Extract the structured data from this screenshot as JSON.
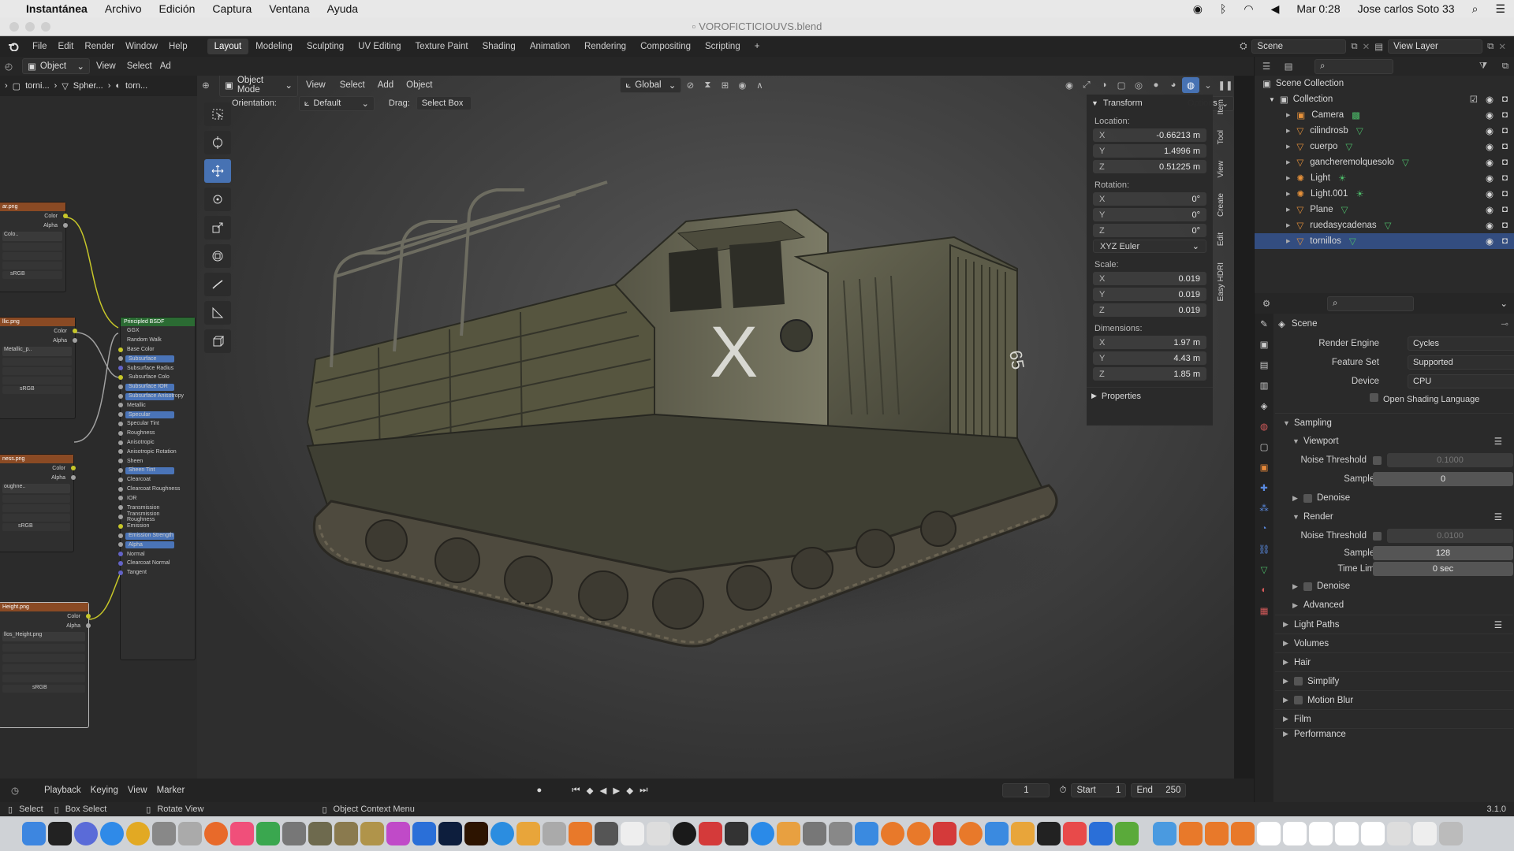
{
  "macbar": {
    "app_name": "Instantánea",
    "menus": [
      "Archivo",
      "Edición",
      "Captura",
      "Ventana",
      "Ayuda"
    ],
    "clock": "Mar 0:28",
    "user": "Jose carlos Soto 33"
  },
  "window": {
    "title": "VOROFICTICIOUVS.blend"
  },
  "blender_menus": [
    "File",
    "Edit",
    "Render",
    "Window",
    "Help"
  ],
  "workspaces": [
    "Layout",
    "Modeling",
    "Sculpting",
    "UV Editing",
    "Texture Paint",
    "Shading",
    "Animation",
    "Rendering",
    "Compositing",
    "Scripting"
  ],
  "scene_selector": "Scene",
  "view_layer": "View Layer",
  "node_editor": {
    "object_dd": "Object",
    "menus": [
      "View",
      "Select",
      "Ad"
    ],
    "breadcrumbs": [
      "torni...",
      "Spher...",
      "torn..."
    ],
    "tex_nodes": [
      {
        "name": "ar.png",
        "file": "Colo..",
        "colorspace": "sRGB"
      },
      {
        "name": "llic.png",
        "file": "Metallic_p..",
        "colorspace": "sRGB"
      },
      {
        "name": "ness.png",
        "file": "oughne..",
        "colorspace": "sRGB"
      },
      {
        "name": "Height.png",
        "file": "llos_Height.png",
        "colorspace": "sRGB"
      }
    ],
    "socket_color": "Color",
    "socket_alpha": "Alpha",
    "bsdf_title": "Principled BSDF",
    "bsdf_rows": [
      "GGX",
      "Random Walk",
      "Base Color",
      "Subsurface",
      "Subsurface Radius",
      "Subsurface Colo",
      "Subsurface IOR",
      "Subsurface Anisotropy",
      "Metallic",
      "Specular",
      "Specular Tint",
      "Roughness",
      "Anisotropic",
      "Anisotropic Rotation",
      "Sheen",
      "Sheen Tint",
      "Clearcoat",
      "Clearcoat Roughness",
      "IOR",
      "Transmission",
      "Transmission Roughness",
      "Emission",
      "Emission Strength",
      "Alpha",
      "Normal",
      "Clearcoat Normal",
      "Tangent"
    ]
  },
  "viewport": {
    "mode": "Object Mode",
    "menus": [
      "View",
      "Select",
      "Add",
      "Object"
    ],
    "orientation_label": "Global",
    "options_label": "Options",
    "sub_orientation_label": "Orientation:",
    "sub_orientation_value": "Default",
    "drag_label": "Drag:",
    "drag_value": "Select Box",
    "truck_marking": "X",
    "truck_number": "65"
  },
  "npanel": {
    "header": "Transform",
    "location_label": "Location:",
    "location": [
      {
        "axis": "X",
        "value": "-0.66213 m"
      },
      {
        "axis": "Y",
        "value": "1.4996 m"
      },
      {
        "axis": "Z",
        "value": "0.51225 m"
      }
    ],
    "rotation_label": "Rotation:",
    "rotation": [
      {
        "axis": "X",
        "value": "0°"
      },
      {
        "axis": "Y",
        "value": "0°"
      },
      {
        "axis": "Z",
        "value": "0°"
      }
    ],
    "rotation_mode": "XYZ Euler",
    "scale_label": "Scale:",
    "scale": [
      {
        "axis": "X",
        "value": "0.019"
      },
      {
        "axis": "Y",
        "value": "0.019"
      },
      {
        "axis": "Z",
        "value": "0.019"
      }
    ],
    "dimensions_label": "Dimensions:",
    "dimensions": [
      {
        "axis": "X",
        "value": "1.97 m"
      },
      {
        "axis": "Y",
        "value": "4.43 m"
      },
      {
        "axis": "Z",
        "value": "1.85 m"
      }
    ],
    "properties_label": "Properties",
    "side_tabs": [
      "Item",
      "Tool",
      "View",
      "Create",
      "Edit",
      "Easy HDRI"
    ]
  },
  "outliner": {
    "scene_collection": "Scene Collection",
    "collection": "Collection",
    "items": [
      {
        "name": "Camera",
        "kind": "camera"
      },
      {
        "name": "cilindrosb",
        "kind": "mesh"
      },
      {
        "name": "cuerpo",
        "kind": "mesh"
      },
      {
        "name": "gancheremolquesolo",
        "kind": "mesh"
      },
      {
        "name": "Light",
        "kind": "light"
      },
      {
        "name": "Light.001",
        "kind": "light"
      },
      {
        "name": "Plane",
        "kind": "mesh"
      },
      {
        "name": "ruedasycadenas",
        "kind": "mesh"
      },
      {
        "name": "tornillos",
        "kind": "mesh",
        "selected": true
      }
    ]
  },
  "properties": {
    "scene_label": "Scene",
    "render_engine_label": "Render Engine",
    "render_engine": "Cycles",
    "feature_set_label": "Feature Set",
    "feature_set": "Supported",
    "device_label": "Device",
    "device": "CPU",
    "osl_label": "Open Shading Language",
    "sampling": "Sampling",
    "viewport": "Viewport",
    "noise_threshold_label": "Noise Threshold",
    "viewport_noise": "0.1000",
    "samples_label": "Samples",
    "viewport_samples": "0",
    "denoise": "Denoise",
    "render": "Render",
    "render_noise": "0.0100",
    "render_samples": "128",
    "time_limit_label": "Time Limit",
    "time_limit": "0 sec",
    "advanced": "Advanced",
    "light_paths": "Light Paths",
    "volumes": "Volumes",
    "hair": "Hair",
    "simplify": "Simplify",
    "motion_blur": "Motion Blur",
    "film": "Film",
    "performance": "Performance"
  },
  "timeline": {
    "menus": [
      "Playback",
      "Keying",
      "View",
      "Marker"
    ],
    "current_frame": "1",
    "start_label": "Start",
    "start": "1",
    "end_label": "End",
    "end": "250"
  },
  "status": {
    "select": "Select",
    "box_select": "Box Select",
    "rotate_view": "Rotate View",
    "context_menu": "Object Context Menu",
    "version": "3.1.0"
  },
  "colors": {
    "accent": "#4772b3",
    "selected_row": "#334d80",
    "tex_node_header": "#8a4a24",
    "bsdf_header": "#2b6b33",
    "socket_yellow": "#c7c729",
    "socket_purple": "#6363c7",
    "socket_grey": "#a1a1a1"
  }
}
